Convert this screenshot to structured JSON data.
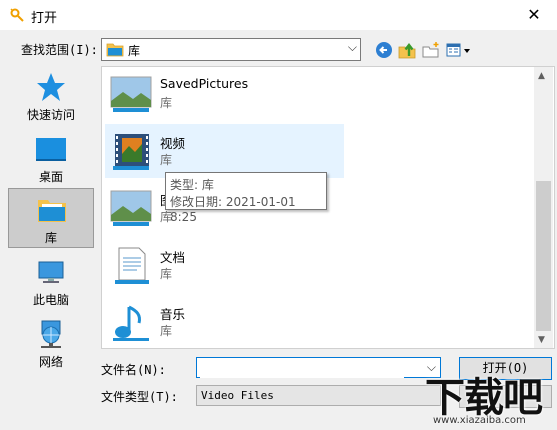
{
  "window": {
    "title": "打开",
    "close_glyph": "✕"
  },
  "lookin": {
    "label": "查找范围(I):",
    "value": "库"
  },
  "places": [
    {
      "label": "快速访问",
      "icon": "star-icon"
    },
    {
      "label": "桌面",
      "icon": "desktop-icon"
    },
    {
      "label": "库",
      "icon": "library-icon",
      "selected": true
    },
    {
      "label": "此电脑",
      "icon": "computer-icon"
    },
    {
      "label": "网络",
      "icon": "network-icon"
    }
  ],
  "items": [
    {
      "name": "SavedPictures",
      "type": "库",
      "icon": "pictures-library-icon"
    },
    {
      "name": "视频",
      "type": "库",
      "icon": "videos-library-icon",
      "hover": true
    },
    {
      "name": "图",
      "type": "库",
      "icon": "pictures-library-icon"
    },
    {
      "name": "文档",
      "type": "库",
      "icon": "documents-library-icon"
    },
    {
      "name": "音乐",
      "type": "库",
      "icon": "music-library-icon"
    }
  ],
  "tooltip": {
    "line1": "类型: 库",
    "line2": "修改日期: 2021-01-01 8:25"
  },
  "filename": {
    "label": "文件名(N):",
    "value": ""
  },
  "filetype": {
    "label": "文件类型(T):",
    "value": "Video Files"
  },
  "buttons": {
    "open": "打开(O)"
  },
  "watermark": {
    "text": "下载吧",
    "url": "www.xiazaiba.com"
  }
}
